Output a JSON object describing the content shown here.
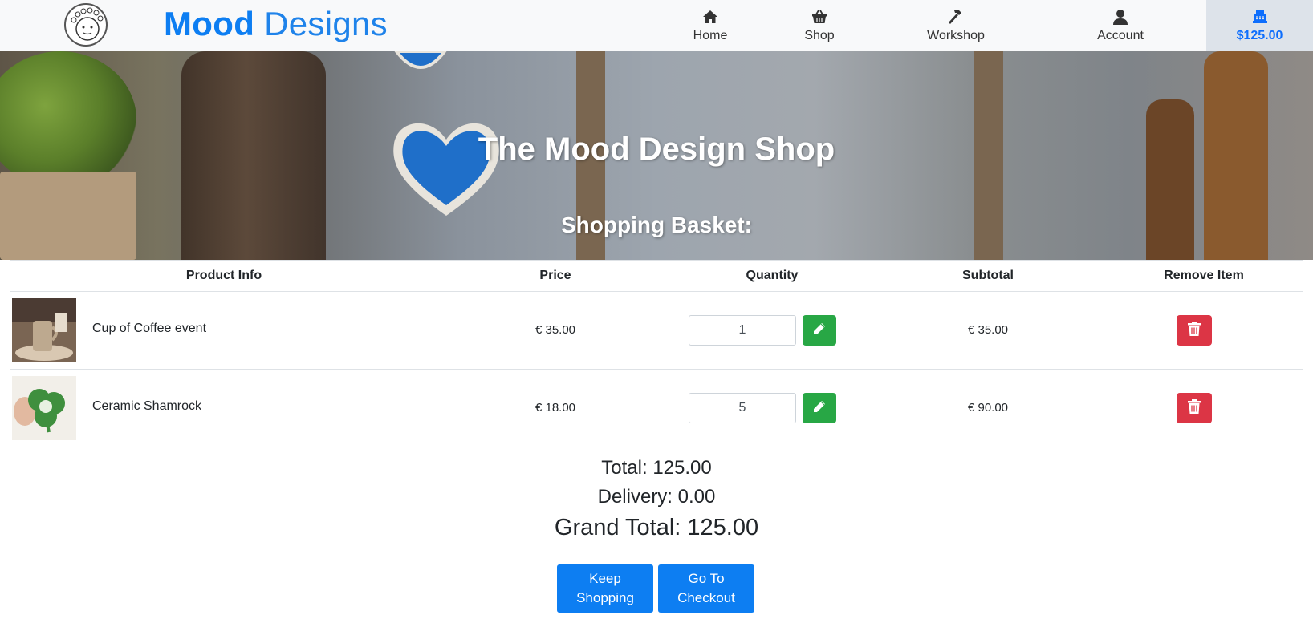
{
  "brand": {
    "part1": "Mood",
    "part2": " Designs"
  },
  "nav": {
    "home": "Home",
    "shop": "Shop",
    "workshop": "Workshop",
    "account": "Account",
    "basket_total": "$125.00"
  },
  "hero": {
    "title": "The Mood Design Shop",
    "subtitle": "Shopping Basket:"
  },
  "table": {
    "headers": [
      "Product Info",
      "Price",
      "Quantity",
      "Subtotal",
      "Remove Item"
    ],
    "rows": [
      {
        "name": "Cup of Coffee event",
        "price": "€ 35.00",
        "quantity": "1",
        "subtotal": "€ 35.00"
      },
      {
        "name": "Ceramic Shamrock",
        "price": "€ 18.00",
        "quantity": "5",
        "subtotal": "€ 90.00"
      }
    ]
  },
  "totals": {
    "total": "Total: 125.00",
    "delivery": "Delivery: 0.00",
    "grand": "Grand Total: 125.00"
  },
  "buttons": {
    "keep_shopping": "Keep Shopping",
    "checkout": "Go To Checkout"
  },
  "colors": {
    "brand": "#0d7ef2",
    "edit": "#28a745",
    "delete": "#dc3545",
    "active_nav_bg": "#dde3ea"
  },
  "icons": {
    "home": "home-icon",
    "shop": "basket-icon",
    "workshop": "hammer-icon",
    "account": "user-icon",
    "basket": "cash-register-icon",
    "edit": "pencil-icon",
    "delete": "trash-icon"
  }
}
